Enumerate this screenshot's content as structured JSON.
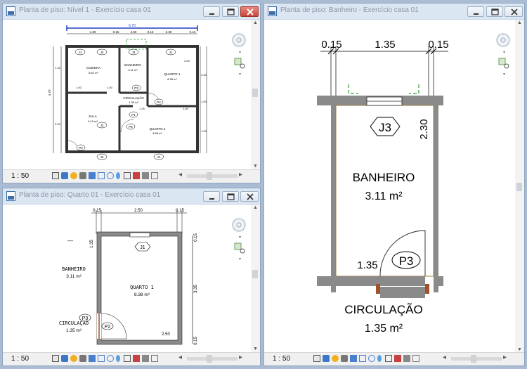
{
  "windows": {
    "nivel": {
      "title": "Planta de piso: Nível 1 - Exercício casa 01",
      "scale": "1 : 50"
    },
    "quarto": {
      "title": "Planta de piso: Quarto 01 - Exercício casa 01",
      "scale": "1 : 50"
    },
    "banheiro": {
      "title": "Planta de piso: Banheiro - Exercício casa 01",
      "scale": "1 : 50"
    }
  },
  "plan_nivel": {
    "overall_dim": "6.70",
    "top_dims": [
      "1.30",
      "0.15",
      "2.50",
      "0.15",
      "2.30",
      "0.15"
    ],
    "left_dim": "4.70",
    "rooms": [
      {
        "name": "COZINHA",
        "area": "8.62 m²"
      },
      {
        "name": "BANHEIRO",
        "area": "3.11 m²"
      },
      {
        "name": "QUARTO 1",
        "area": "8.38 m²"
      },
      {
        "name": "CIRCULAÇÃO",
        "area": "1.35 m²"
      },
      {
        "name": "SALA",
        "area": "9.15 m²"
      },
      {
        "name": "QUARTO 2",
        "area": "8.85 m²"
      }
    ],
    "tags": [
      "J1",
      "J2",
      "J3",
      "J1",
      "P1",
      "P2",
      "P3",
      "P4",
      "J2",
      "J1",
      "P5",
      "J2"
    ],
    "dim_labels": [
      "1.00",
      "1.00",
      "1.00",
      "2.50",
      "1.00",
      "1.50",
      "1.25",
      "3.00",
      "1.25",
      "2.00"
    ]
  },
  "plan_quarto": {
    "top_dims": [
      "0.15",
      "2.50",
      "0.15"
    ],
    "right_dims": [
      "0.15",
      "3.35",
      "0.15"
    ],
    "left_dim": "1.35",
    "bottom_dim": "2.50",
    "room": {
      "name": "QUARTO 1",
      "area": "8.38 m²"
    },
    "neighbor1": {
      "name": "BANHEIRO",
      "area": "3.11 m²"
    },
    "neighbor2": {
      "name": "CIRCULAÇÃO",
      "area": "1.35 m²"
    },
    "tags": {
      "window": "J1",
      "door_a": "P3",
      "door_b": "P2"
    },
    "dash": "—"
  },
  "plan_banheiro": {
    "top_dims": [
      "0.15",
      "1.35",
      "0.15"
    ],
    "right_dim": "2.30",
    "left_dim": "1.35",
    "room": {
      "name": "BANHEIRO",
      "area": "3.11 m²"
    },
    "neighbor": {
      "name": "CIRCULAÇÃO",
      "area": "1.35 m²"
    },
    "tags": {
      "window": "J3",
      "door": "P3"
    }
  },
  "colors": {
    "titlebar": "#dbe6f3",
    "title_text": "#8d96a3",
    "wall": "#8a8a8a",
    "dim_line": "#000000",
    "selection_blue": "#1f3fbf",
    "crop_green": "#2a9a38",
    "door_brown": "#a0522d",
    "background": "#a9bcd3"
  },
  "icons": [
    "app-icon",
    "minimize-icon",
    "maximize-icon",
    "close-icon",
    "steering-wheel-icon",
    "zoom-region-icon",
    "detail-level-icon",
    "visual-style-icon",
    "sun-path-icon",
    "shadows-icon",
    "crop-view-icon",
    "show-crop-icon",
    "temporary-hide-icon",
    "reveal-hidden-icon",
    "temp-properties-icon",
    "worksharing-icon",
    "analysis-icon",
    "highlight-displacement-icon"
  ]
}
